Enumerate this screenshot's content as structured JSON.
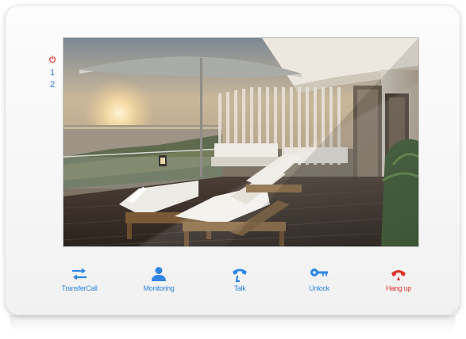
{
  "indicators": {
    "power_icon": "power-icon",
    "line_1": "1",
    "line_2": "2"
  },
  "screen": {
    "content": "balcony-camera-view"
  },
  "buttons": [
    {
      "label": "TransferCall",
      "icon": "transfer-arrows-icon",
      "color": "#2f86e6"
    },
    {
      "label": "Monitoring",
      "icon": "person-icon",
      "color": "#2f86e6"
    },
    {
      "label": "Talk",
      "icon": "phone-icon",
      "color": "#2f86e6"
    },
    {
      "label": "Unlock",
      "icon": "key-icon",
      "color": "#2f86e6"
    },
    {
      "label": "Hang up",
      "icon": "hang-up-phone-icon",
      "color": "#e0342c"
    }
  ],
  "colors": {
    "accent": "#2f86e6",
    "hangup": "#e0342c",
    "bezel": "#f6f6f6"
  }
}
